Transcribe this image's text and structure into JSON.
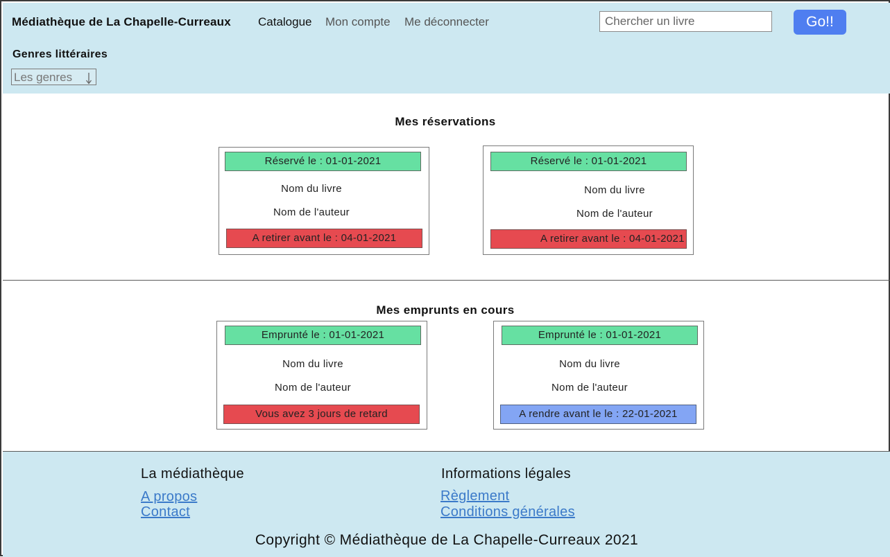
{
  "header": {
    "site_title": "Médiathèque de La Chapelle-Curreaux",
    "nav": [
      {
        "label": "Catalogue"
      },
      {
        "label": "Mon compte"
      },
      {
        "label": "Me déconnecter"
      }
    ],
    "search": {
      "placeholder": "Chercher un livre",
      "button_label": "Go!!"
    },
    "genres": {
      "title": "Genres littéraires",
      "select_value": "Les genres"
    },
    "colors": {
      "background": "#cde8f1",
      "button": "#4f7ef0"
    }
  },
  "reservations": {
    "title": "Mes réservations",
    "cards": [
      {
        "top": "Réservé le : 01-01-2021",
        "book": "Nom du livre",
        "author": "Nom de l'auteur",
        "bottom": "A retirer avant le : 04-01-2021",
        "status_color": "red"
      },
      {
        "top": "Réservé le : 01-01-2021",
        "book": "Nom du livre",
        "author": "Nom de l'auteur",
        "bottom": "A retirer avant le : 04-01-2021",
        "status_color": "red"
      }
    ]
  },
  "loans": {
    "title": "Mes emprunts en cours",
    "cards": [
      {
        "top": "Emprunté le : 01-01-2021",
        "book": "Nom du livre",
        "author": "Nom de l'auteur",
        "bottom": "Vous avez 3 jours de retard",
        "status_color": "red"
      },
      {
        "top": "Emprunté le : 01-01-2021",
        "book": "Nom du livre",
        "author": "Nom de l'auteur",
        "bottom": "A rendre avant le le : 22-01-2021",
        "status_color": "blue"
      }
    ]
  },
  "footer": {
    "col1": {
      "heading": "La médiathèque",
      "links": [
        "A propos",
        "Contact"
      ]
    },
    "col2": {
      "heading": "Informations légales",
      "links": [
        "Règlement",
        "Conditions générales"
      ]
    },
    "copyright": "Copyright © Médiathèque de La Chapelle-Curreaux 2021"
  },
  "colors": {
    "green": "#66e0a2",
    "red": "#e64a50",
    "blue": "#83a5f4",
    "link": "#3b7ac9"
  }
}
